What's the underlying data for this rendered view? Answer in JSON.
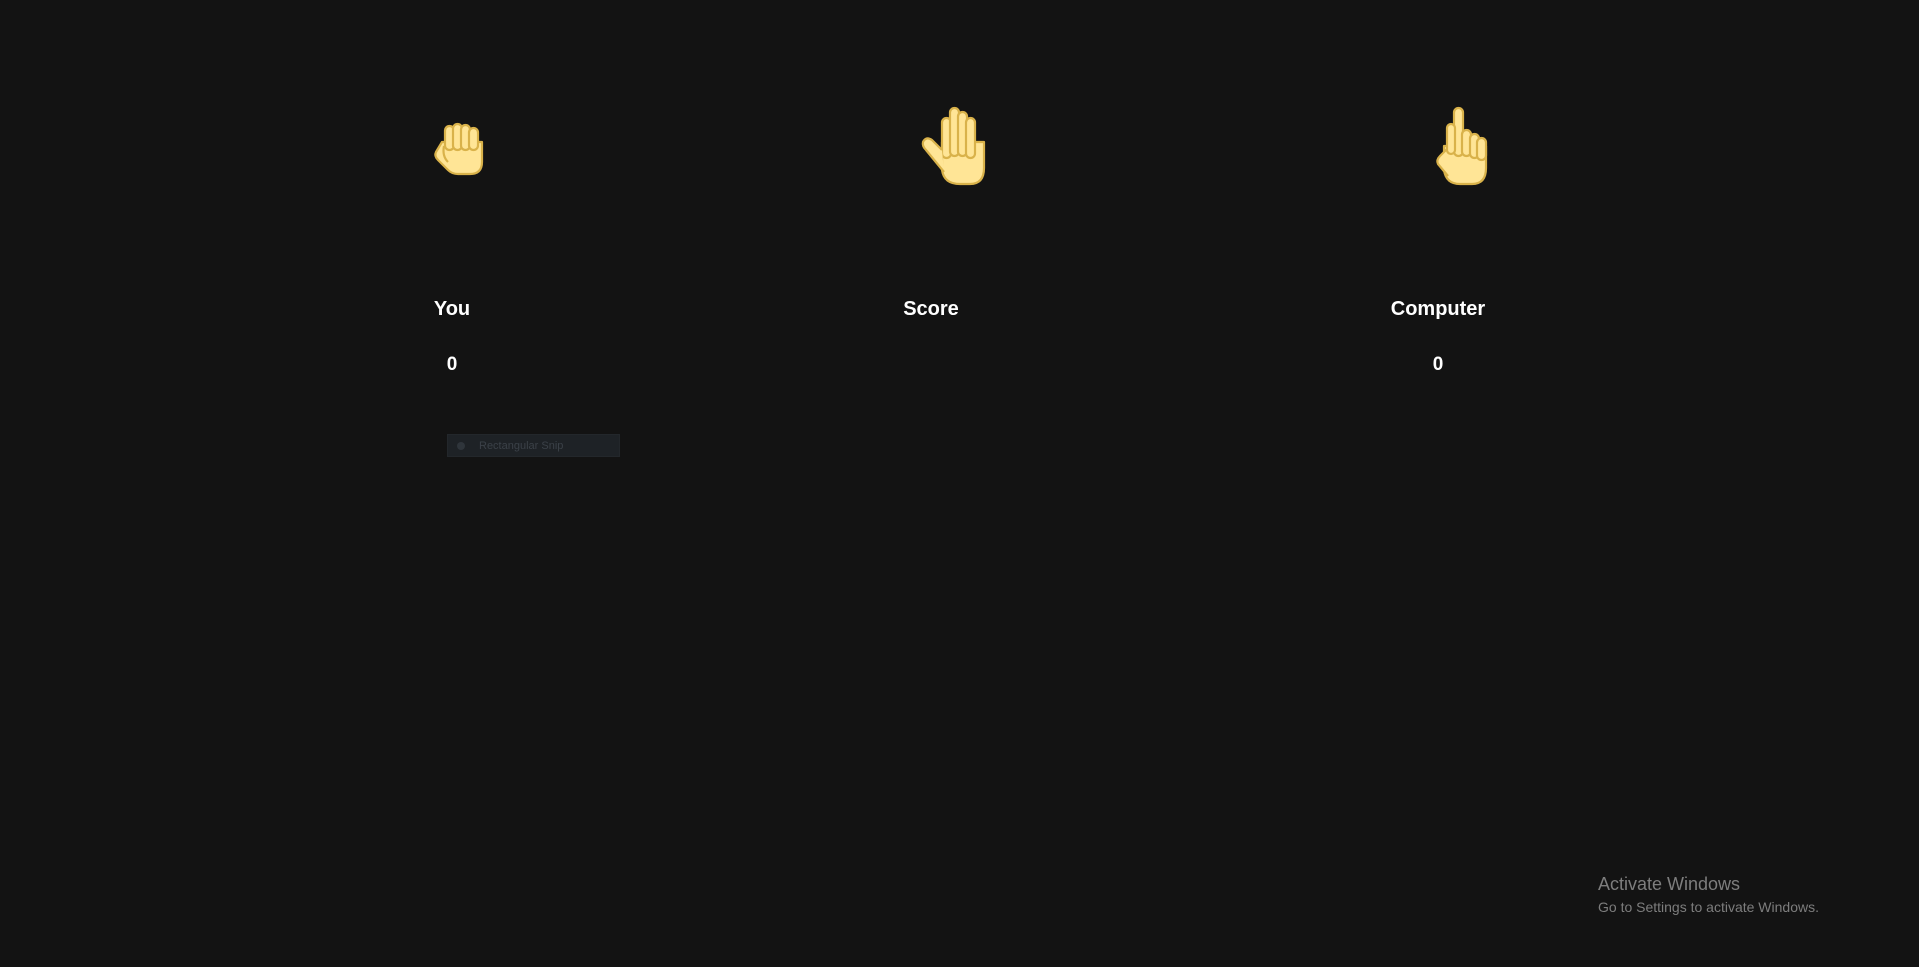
{
  "game": {
    "choices": [
      {
        "name": "rock",
        "icon": "fist-hand-icon"
      },
      {
        "name": "paper",
        "icon": "open-hand-icon"
      },
      {
        "name": "scissors",
        "icon": "pointing-hand-icon"
      }
    ],
    "hand_color": "#ffe596",
    "hand_outline": "#d9b24a"
  },
  "scoreboard": {
    "you_label": "You",
    "title": "Score",
    "computer_label": "Computer",
    "you_score": "0",
    "computer_score": "0"
  },
  "overlay": {
    "snip_label": "Rectangular Snip"
  },
  "watermark": {
    "title": "Activate Windows",
    "subtitle": "Go to Settings to activate Windows."
  }
}
